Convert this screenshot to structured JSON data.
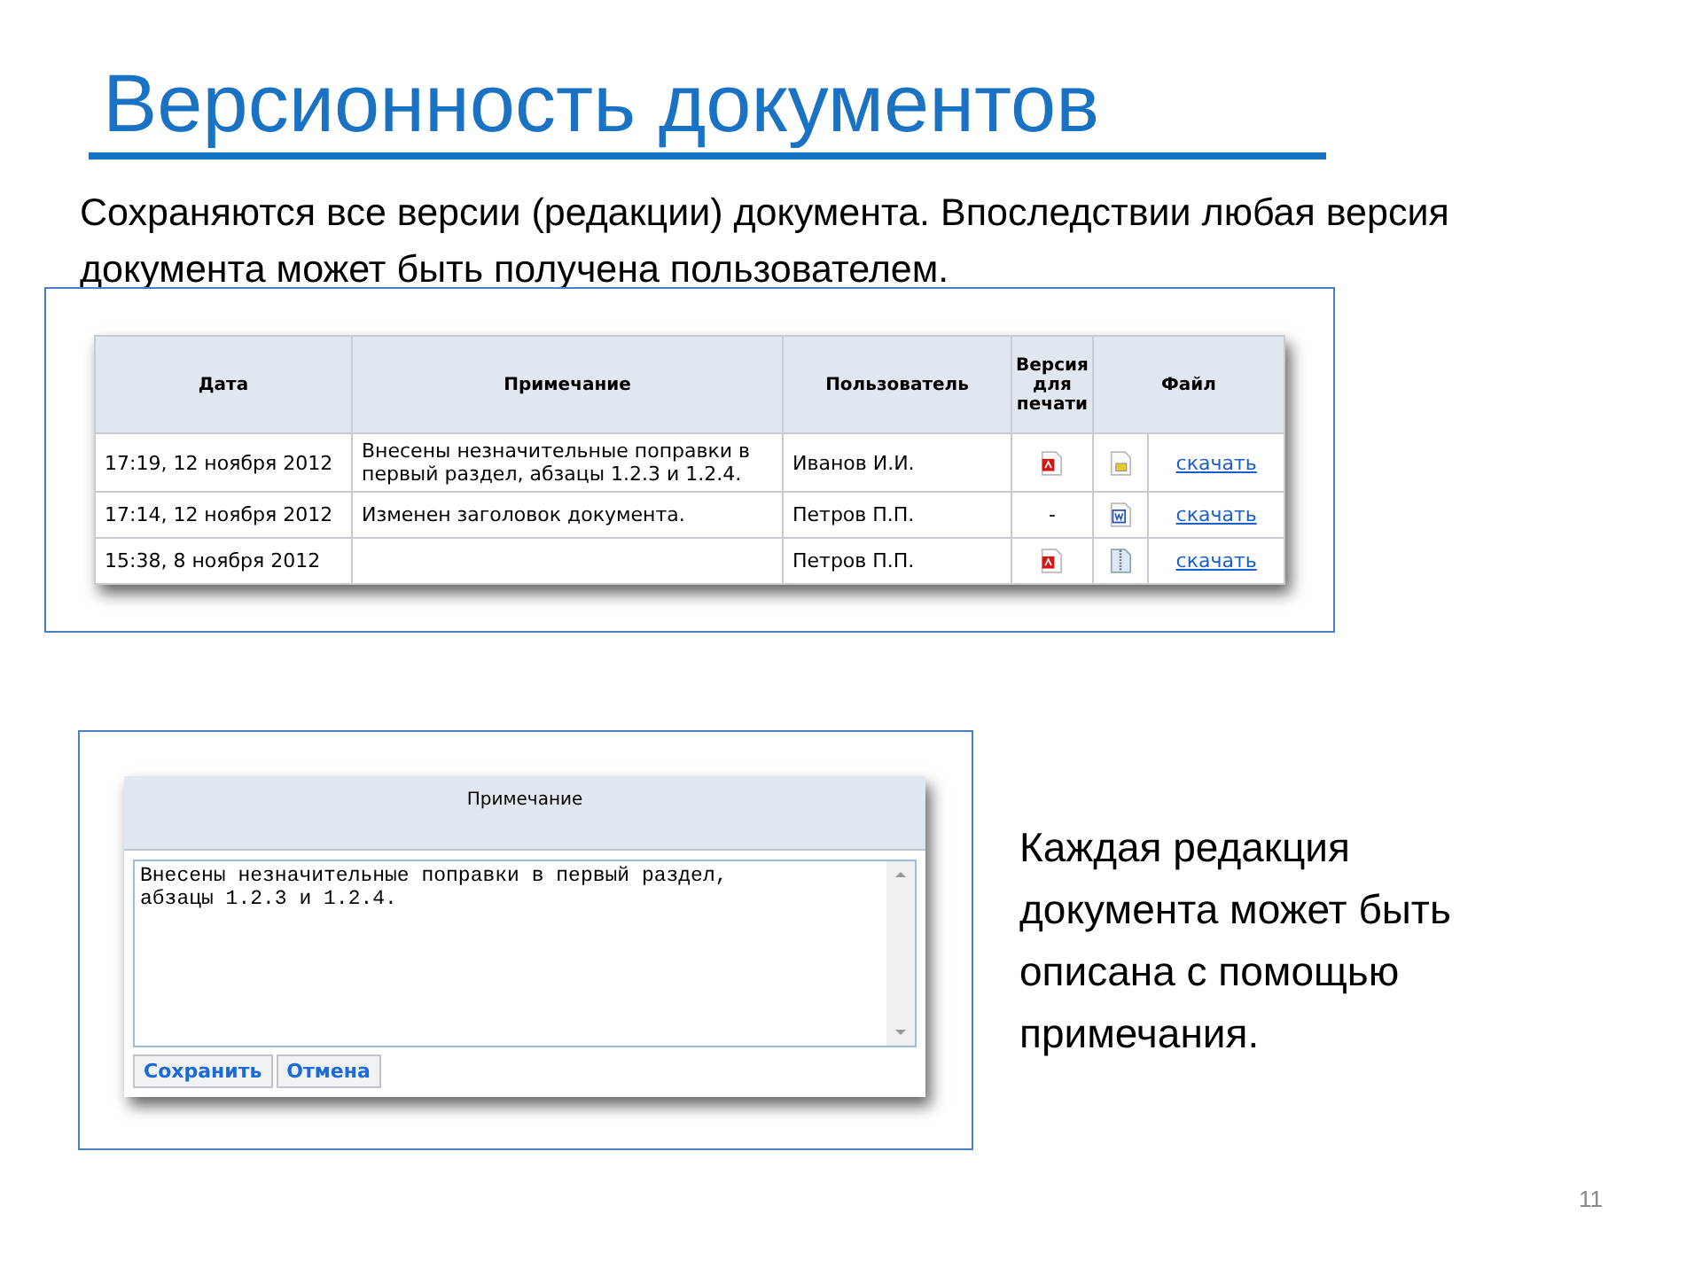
{
  "slide": {
    "title": "Версионность документов",
    "intro": "Сохраняются все версии (редакции) документа. Впоследствии любая версия документа может быть получена пользователем.",
    "side_text": "Каждая редакция документа может быть описана с помощью примечания.",
    "page_number": "11"
  },
  "table": {
    "columns": [
      "Дата",
      "Примечание",
      "Пользователь",
      "Версия для печати",
      "Файл"
    ],
    "rows": [
      {
        "date": "17:19, 12 ноября 2012",
        "note": "Внесены незначительные поправки в первый раздел, абзацы 1.2.3 и 1.2.4.",
        "user": "Иванов И.И.",
        "print": {
          "kind": "pdf"
        },
        "file": {
          "kind": "image"
        },
        "link": "скачать"
      },
      {
        "date": "17:14, 12 ноября 2012",
        "note": "Изменен заголовок документа.",
        "user": "Петров П.П.",
        "print": {
          "kind": "text",
          "text": "-"
        },
        "file": {
          "kind": "word"
        },
        "link": "скачать"
      },
      {
        "date": "15:38, 8 ноября 2012",
        "user": "Петров П.П.",
        "print": {
          "kind": "pdf"
        },
        "file": {
          "kind": "archive"
        },
        "link": "скачать"
      }
    ]
  },
  "dialog": {
    "title": "Примечание",
    "value": "Внесены незначительные поправки в первый раздел,\nабзацы 1.2.3 и 1.2.4.",
    "buttons": [
      "Сохранить",
      "Отмена"
    ]
  }
}
